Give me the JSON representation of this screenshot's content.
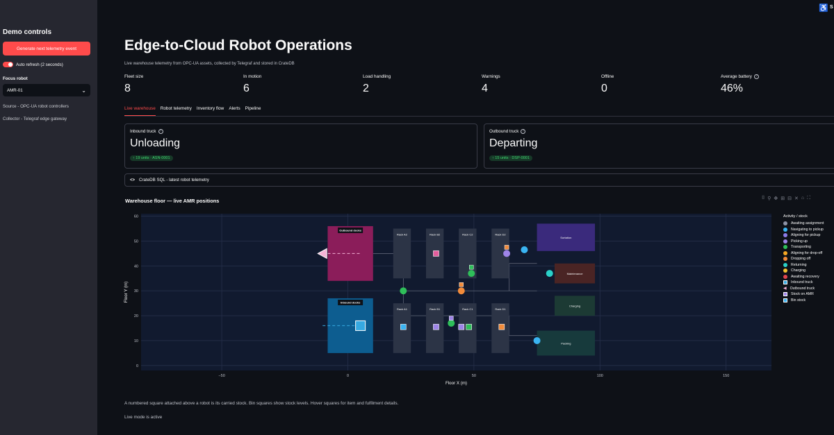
{
  "sidebar": {
    "title": "Demo controls",
    "generate_button": "Generate next telemetry event",
    "auto_refresh_label": "Auto refresh (2 seconds)",
    "focus_label": "Focus robot",
    "focus_value": "AMR-01",
    "source_caption": "Source - OPC-UA robot controllers",
    "collector_caption": "Collector - Telegraf edge gateway"
  },
  "header": {
    "accessibility_icon": "accessibility-icon",
    "truncated_text": "S"
  },
  "page": {
    "title": "Edge-to-Cloud Robot Operations",
    "subtitle": "Live warehouse telemetry from OPC-UA assets, collected by Telegraf and stored in CrateDB"
  },
  "metrics": [
    {
      "label": "Fleet size",
      "value": "8"
    },
    {
      "label": "In motion",
      "value": "6"
    },
    {
      "label": "Load handling",
      "value": "2"
    },
    {
      "label": "Warnings",
      "value": "4"
    },
    {
      "label": "Offline",
      "value": "0"
    },
    {
      "label": "Average battery",
      "value": "46%"
    }
  ],
  "tabs": [
    "Live warehouse",
    "Robot telemetry",
    "Inventory flow",
    "Alerts",
    "Pipeline"
  ],
  "cards": [
    {
      "label": "Inbound truck",
      "value": "Unloading",
      "delta": "↑ 19 units · ASN-0001"
    },
    {
      "label": "Outbound truck",
      "value": "Departing",
      "delta": "↑ 15 units · DSP-0001"
    }
  ],
  "expander": {
    "icon": "code-icon",
    "label": "CrateDB SQL - latest robot telemetry"
  },
  "plot": {
    "title": "Warehouse floor — live AMR positions"
  },
  "chart_data": {
    "type": "scatter",
    "xlabel": "Floor X (m)",
    "ylabel": "Floor Y (m)",
    "xlim": [
      -82,
      168
    ],
    "ylim": [
      -2,
      61
    ],
    "xticks": [
      -50,
      0,
      50,
      100,
      150
    ],
    "xtick_labels": [
      "−50",
      "0",
      "50",
      "100",
      "150"
    ],
    "yticks": [
      0,
      10,
      20,
      30,
      40,
      50,
      60
    ],
    "grid": true,
    "legend_title": "Activity / stock",
    "legend_position": "right",
    "zones": [
      {
        "label": "Outbound docks",
        "x": [
          -8,
          10
        ],
        "y": [
          34,
          56
        ],
        "color": "#8b1d5a"
      },
      {
        "label": "Inbound docks",
        "x": [
          -8,
          10
        ],
        "y": [
          5,
          27
        ],
        "color": "#0d5d90"
      },
      {
        "label": "Rack A2",
        "x": [
          18,
          25
        ],
        "y": [
          35,
          55
        ],
        "color": "#2c3446"
      },
      {
        "label": "Rack B2",
        "x": [
          31,
          38
        ],
        "y": [
          35,
          55
        ],
        "color": "#2c3446"
      },
      {
        "label": "Rack C2",
        "x": [
          44,
          51
        ],
        "y": [
          35,
          55
        ],
        "color": "#2c3446"
      },
      {
        "label": "Rack D2",
        "x": [
          57,
          64
        ],
        "y": [
          35,
          55
        ],
        "color": "#2c3446"
      },
      {
        "label": "Rack A1",
        "x": [
          18,
          25
        ],
        "y": [
          5,
          25
        ],
        "color": "#2c3446"
      },
      {
        "label": "Rack B1",
        "x": [
          31,
          38
        ],
        "y": [
          5,
          25
        ],
        "color": "#2c3446"
      },
      {
        "label": "Rack C1",
        "x": [
          44,
          51
        ],
        "y": [
          5,
          25
        ],
        "color": "#2c3446"
      },
      {
        "label": "Rack D1",
        "x": [
          57,
          64
        ],
        "y": [
          5,
          25
        ],
        "color": "#2c3446"
      },
      {
        "label": "Sortation",
        "x": [
          75,
          98
        ],
        "y": [
          46,
          57
        ],
        "color": "#3a2a7c"
      },
      {
        "label": "Maintenance",
        "x": [
          82,
          98
        ],
        "y": [
          33,
          41
        ],
        "color": "#4a2424"
      },
      {
        "label": "Charging",
        "x": [
          82,
          98
        ],
        "y": [
          20,
          28
        ],
        "color": "#1c3a34"
      },
      {
        "label": "Packing",
        "x": [
          75,
          98
        ],
        "y": [
          4,
          14
        ],
        "color": "#173a3c"
      }
    ],
    "series": [
      {
        "name": "Returning",
        "color": "#2ad1c9",
        "points": [
          [
            80,
            37
          ]
        ]
      },
      {
        "name": "Navigating to pickup",
        "color": "#3ab4f2",
        "points": [
          [
            70,
            46.5
          ],
          [
            75,
            10
          ]
        ]
      },
      {
        "name": "Transporting",
        "color": "#2fbf5a",
        "points": [
          [
            22,
            30
          ],
          [
            49,
            37
          ],
          [
            41,
            17
          ]
        ]
      },
      {
        "name": "Picking up",
        "color": "#9e84e8",
        "points": [
          [
            63,
            45
          ]
        ]
      },
      {
        "name": "Dropping off",
        "color": "#f28b3a",
        "points": [
          [
            45,
            30
          ]
        ]
      },
      {
        "name": "Inbound truck",
        "color": "#36a9e1",
        "points": [
          [
            5,
            16
          ]
        ]
      },
      {
        "name": "Outbound truck",
        "color": "#f5b3d6",
        "points": [
          [
            -10,
            45
          ]
        ]
      }
    ],
    "stock_squares": [
      {
        "x": [
          35,
          45,
          22,
          35,
          48,
          61
        ],
        "y": [
          45,
          15.5,
          15.5,
          15.5,
          15.5,
          15.5
        ],
        "labels": [
          "",
          "",
          "",
          "",
          "",
          ""
        ]
      }
    ],
    "legend": [
      {
        "name": "Awaiting assignment",
        "color": "#8d93a6",
        "shape": "dot"
      },
      {
        "name": "Navigating to pickup",
        "color": "#3ab4f2",
        "shape": "dot"
      },
      {
        "name": "Aligning for pickup",
        "color": "#8c7be8",
        "shape": "dot"
      },
      {
        "name": "Picking up",
        "color": "#9e84e8",
        "shape": "dot"
      },
      {
        "name": "Transporting",
        "color": "#2fbf5a",
        "shape": "dot"
      },
      {
        "name": "Aligning for drop-off",
        "color": "#f5a623",
        "shape": "dot"
      },
      {
        "name": "Dropping off",
        "color": "#f28b3a",
        "shape": "dot"
      },
      {
        "name": "Returning",
        "color": "#2ad1c9",
        "shape": "dot"
      },
      {
        "name": "Charging",
        "color": "#f2c230",
        "shape": "dot"
      },
      {
        "name": "Awaiting recovery",
        "color": "#e0464e",
        "shape": "dot"
      },
      {
        "name": "Inbound truck",
        "color": "#36a9e1",
        "shape": "square"
      },
      {
        "name": "Outbound truck",
        "color": "#f5b3d6",
        "shape": "triangle"
      },
      {
        "name": "Stock on AMR",
        "color": "#9e84e8",
        "shape": "square"
      },
      {
        "name": "Bin stock",
        "color": "#3ab4f2",
        "shape": "square"
      }
    ]
  },
  "footer": {
    "caption": "A numbered square attached above a robot is its carried stock. Bin squares show stock levels. Hover squares for item and fulfilment details.",
    "live": "Live mode is active"
  }
}
